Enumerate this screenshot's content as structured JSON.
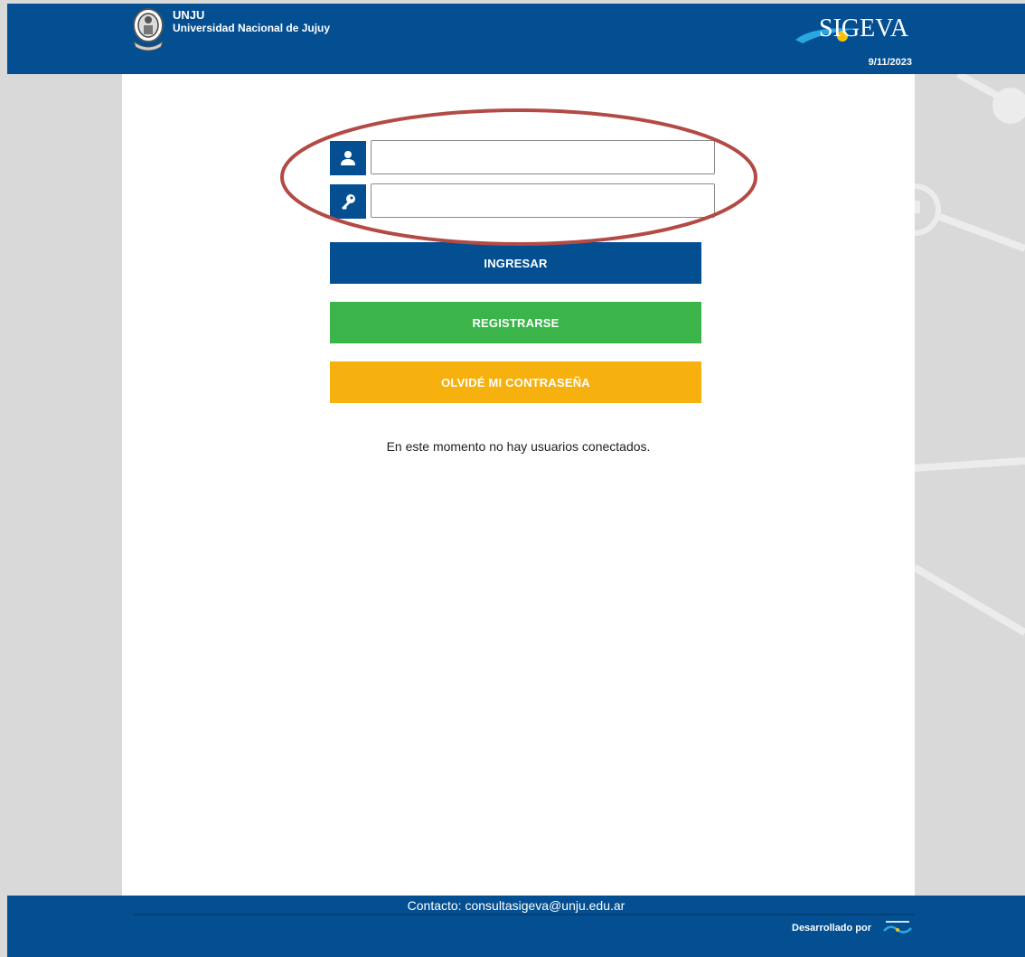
{
  "header": {
    "university_abbr": "UNJU",
    "university_name": "Universidad Nacional de Jujuy",
    "brand": "SIGEVA",
    "date": "9/11/2023"
  },
  "login": {
    "username_icon": "user-icon",
    "password_icon": "key-icon",
    "username_value": "",
    "password_value": ""
  },
  "buttons": {
    "login": "INGRESAR",
    "register": "REGISTRARSE",
    "forgot": "OLVIDÉ MI CONTRASEÑA"
  },
  "status": "En este momento no hay usuarios conectados.",
  "footer": {
    "contact": "Contacto: consultasigeva@unju.edu.ar",
    "developed_by": "Desarrollado por",
    "developer_logo": "conicet-logo"
  },
  "colors": {
    "primary": "#034f91",
    "register": "#3bb54a",
    "forgot": "#f6b10f",
    "highlight": "#b24a45",
    "background": "#d9d9d9"
  }
}
